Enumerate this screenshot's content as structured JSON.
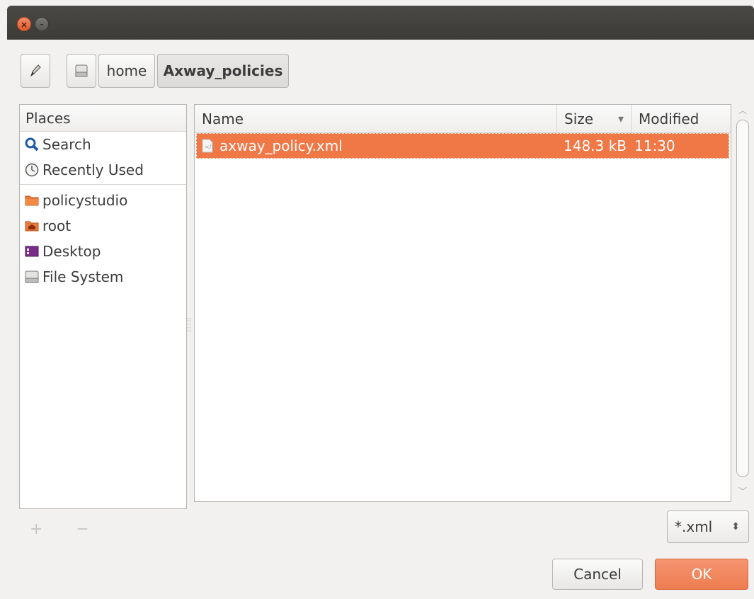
{
  "window": {
    "close_glyph": "×",
    "min_glyph": "–"
  },
  "pathbar": {
    "edit_icon": "pencil-icon",
    "drive_icon": "drive-icon",
    "crumbs": [
      "home",
      "Axway_policies"
    ]
  },
  "places": {
    "header": "Places",
    "items": [
      {
        "label": "Search",
        "icon": "search-icon"
      },
      {
        "label": "Recently Used",
        "icon": "clock-icon"
      },
      {
        "label": "policystudio",
        "icon": "folder-icon"
      },
      {
        "label": "root",
        "icon": "home-folder-icon"
      },
      {
        "label": "Desktop",
        "icon": "desktop-icon"
      },
      {
        "label": "File System",
        "icon": "drive-icon"
      }
    ],
    "add_remove": "+ −"
  },
  "files": {
    "columns": {
      "name": "Name",
      "size": "Size",
      "sort_glyph": "▾",
      "modified": "Modified"
    },
    "rows": [
      {
        "name": "axway_policy.xml",
        "size": "148.3 kB",
        "modified": "11:30"
      }
    ]
  },
  "filter": {
    "value": "*.xml",
    "glyph": "⬍"
  },
  "buttons": {
    "cancel": "Cancel",
    "ok": "OK"
  },
  "colors": {
    "accent": "#f07746",
    "ok_button": "#ee7c50",
    "titlebar": "#3c3b37"
  }
}
